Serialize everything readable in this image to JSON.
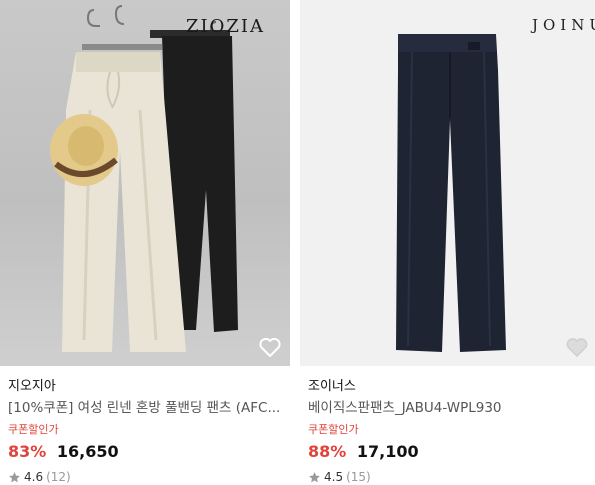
{
  "products": [
    {
      "watermark": "ZIOZIA",
      "brand": "지오지아",
      "title": "[10%쿠폰] 여성 린넨 혼방 풀밴딩 팬츠 (AFC...",
      "coupon_label": "쿠폰할인가",
      "discount": "83%",
      "price": "16,650",
      "rating": "4.6",
      "review_count": "(12)"
    },
    {
      "watermark": "JOINU",
      "brand": "조이너스",
      "title": "베이직스판팬츠_JABU4-WPL930",
      "coupon_label": "쿠폰할인가",
      "discount": "88%",
      "price": "17,100",
      "rating": "4.5",
      "review_count": "(15)"
    }
  ],
  "colors": {
    "discount": "#e0443a",
    "star": "#9a9a9a"
  },
  "icons": [
    "heart-outline-icon",
    "star-icon"
  ]
}
